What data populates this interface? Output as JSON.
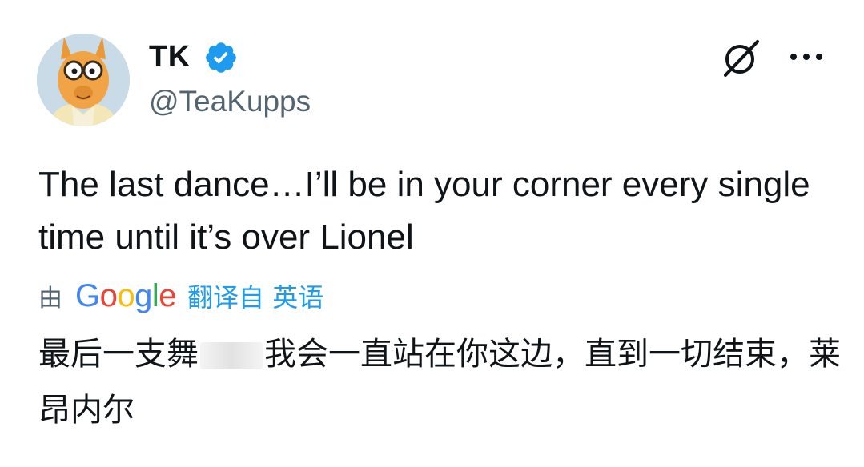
{
  "author": {
    "display_name": "TK",
    "handle": "@TeaKupps",
    "verified": true
  },
  "icons": {
    "verified": "verified-badge-icon",
    "grok": "grok-icon",
    "more": "more-options-icon"
  },
  "tweet": {
    "text": "The last dance…I’ll be in your corner every single time until it’s over Lionel"
  },
  "translation": {
    "by_label": "由",
    "provider_letters": [
      "G",
      "o",
      "o",
      "g",
      "l",
      "e"
    ],
    "link_label": "翻译自 英语",
    "text_part1": "最后一支舞",
    "text_part2": "我会一直站在你这边，直到一切结束，莱昂内尔"
  },
  "colors": {
    "accent": "#1d9bf0",
    "secondary_text": "#536471",
    "primary_text": "#0f1419"
  }
}
